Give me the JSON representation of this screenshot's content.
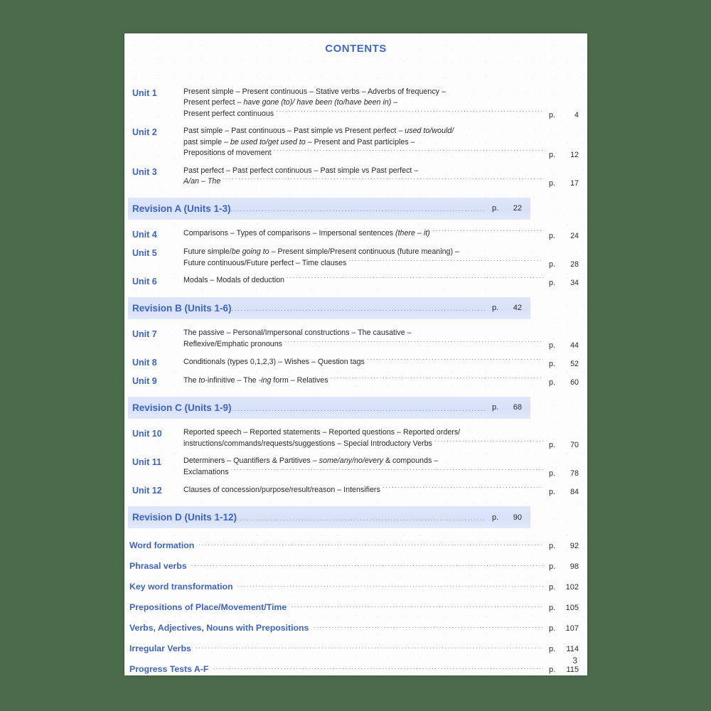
{
  "page": {
    "title": "Contents",
    "folio": "3",
    "colors": {
      "accent_blue": "#3d63c6",
      "title_blue": "#4068c8",
      "revision_band": "#dce4f7",
      "paper": "#fdfdfd",
      "backdrop": "#4a6b4a",
      "body_text": "#2b2b2b"
    }
  },
  "page_prefix": "p.",
  "units": [
    {
      "label": "Unit 1",
      "lines": [
        [
          {
            "t": "Present simple – Present continuous – Stative verbs – Adverbs of frequency –",
            "i": false
          }
        ],
        [
          {
            "t": "Present perfect – ",
            "i": false
          },
          {
            "t": "have gone (to)/ have been (to/have been in)",
            "i": true
          },
          {
            "t": " –",
            "i": false
          }
        ]
      ],
      "last_line": [
        {
          "t": "Present perfect continuous",
          "i": false
        }
      ],
      "page": "4"
    },
    {
      "label": "Unit 2",
      "lines": [
        [
          {
            "t": "Past simple – Past continuous – Past simple vs Present perfect – ",
            "i": false
          },
          {
            "t": "used to/would/",
            "i": true
          }
        ],
        [
          {
            "t": "past simple – ",
            "i": false
          },
          {
            "t": "be used to/get used to",
            "i": true
          },
          {
            "t": " – Present and Past participles –",
            "i": false
          }
        ]
      ],
      "last_line": [
        {
          "t": "Prepositions of movement",
          "i": false
        }
      ],
      "page": "12"
    },
    {
      "label": "Unit 3",
      "lines": [
        [
          {
            "t": "Past perfect – Past perfect continuous – Past simple vs Past perfect –",
            "i": false
          }
        ]
      ],
      "last_line": [
        {
          "t": "A/an",
          "i": true
        },
        {
          "t": " – ",
          "i": false
        },
        {
          "t": "The",
          "i": true
        }
      ],
      "page": "17"
    },
    {
      "label": "Unit 4",
      "lines": [],
      "last_line": [
        {
          "t": "Comparisons – Types of comparisons – Impersonal sentences ",
          "i": false
        },
        {
          "t": "(there – it)",
          "i": true
        }
      ],
      "page": "24"
    },
    {
      "label": "Unit 5",
      "lines": [
        [
          {
            "t": "Future simple/",
            "i": false
          },
          {
            "t": "be going to",
            "i": true
          },
          {
            "t": " – Present simple/Present continuous (future meaning) –",
            "i": false
          }
        ]
      ],
      "last_line": [
        {
          "t": "Future continuous/Future perfect – Time clauses",
          "i": false
        }
      ],
      "page": "28"
    },
    {
      "label": "Unit 6",
      "lines": [],
      "last_line": [
        {
          "t": "Modals – Modals of deduction",
          "i": false
        }
      ],
      "page": "34"
    },
    {
      "label": "Unit 7",
      "lines": [
        [
          {
            "t": "The passive – Personal/Impersonal constructions – The causative –",
            "i": false
          }
        ]
      ],
      "last_line": [
        {
          "t": "Reflexive/Emphatic pronouns",
          "i": false
        }
      ],
      "page": "44"
    },
    {
      "label": "Unit 8",
      "lines": [],
      "last_line": [
        {
          "t": "Conditionals (types 0,1,2,3) – Wishes – Question tags",
          "i": false
        }
      ],
      "page": "52"
    },
    {
      "label": "Unit 9",
      "lines": [],
      "last_line": [
        {
          "t": "The ",
          "i": false
        },
        {
          "t": "to",
          "i": true
        },
        {
          "t": "-infinitive – The ",
          "i": false
        },
        {
          "t": "-ing",
          "i": true
        },
        {
          "t": " form – Relatives",
          "i": false
        }
      ],
      "page": "60"
    },
    {
      "label": "Unit 10",
      "lines": [
        [
          {
            "t": "Reported speech – Reported statements – Reported questions – Reported orders/",
            "i": false
          }
        ]
      ],
      "last_line": [
        {
          "t": "instructions/commands/requests/suggestions – Special Introductory Verbs",
          "i": false
        }
      ],
      "page": "70"
    },
    {
      "label": "Unit 11",
      "lines": [
        [
          {
            "t": "Determiners – Quantifiers & Partitives – ",
            "i": false
          },
          {
            "t": "some/any/no/every",
            "i": true
          },
          {
            "t": " & compounds –",
            "i": false
          }
        ]
      ],
      "last_line": [
        {
          "t": "Exclamations",
          "i": false
        }
      ],
      "page": "78"
    },
    {
      "label": "Unit 12",
      "lines": [],
      "last_line": [
        {
          "t": "Clauses of concession/purpose/result/reason – Intensifiers",
          "i": false
        }
      ],
      "page": "84"
    }
  ],
  "revisions": [
    {
      "label": "Revision A (Units 1-3)",
      "page": "22",
      "after_unit": "Unit 3"
    },
    {
      "label": "Revision B (Units 1-6)",
      "page": "42",
      "after_unit": "Unit 6"
    },
    {
      "label": "Revision C (Units 1-9)",
      "page": "68",
      "after_unit": "Unit 9"
    },
    {
      "label": "Revision D (Units 1-12)",
      "page": "90",
      "after_unit": "Unit 12"
    }
  ],
  "sections": [
    {
      "label": "Word formation",
      "page": "92"
    },
    {
      "label": "Phrasal verbs",
      "page": "98"
    },
    {
      "label": "Key word transformation",
      "page": "102"
    },
    {
      "label": "Prepositions of Place/Movement/Time",
      "page": "105"
    },
    {
      "label": "Verbs, Adjectives, Nouns with Prepositions",
      "page": "107"
    },
    {
      "label": "Irregular Verbs",
      "page": "114"
    },
    {
      "label": "Progress Tests A-F",
      "page": "115"
    }
  ]
}
